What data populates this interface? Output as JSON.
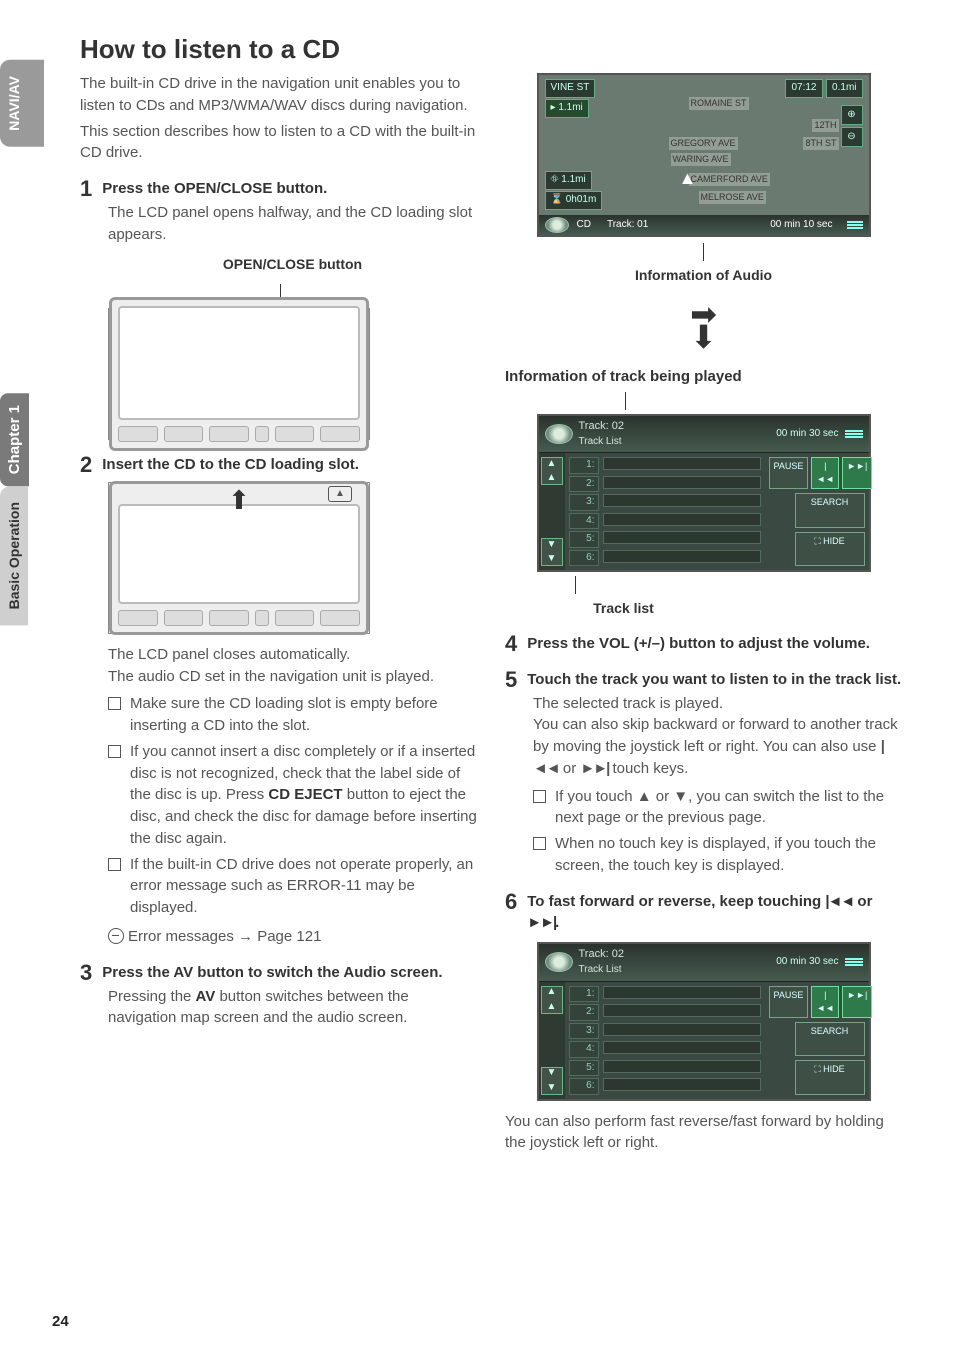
{
  "page_number": "24",
  "side": {
    "navav": "NAVI/AV",
    "chapter": "Chapter 1",
    "section": "Basic Operation"
  },
  "title_a": "How to listen to a ",
  "title_b": "CD",
  "intro1": "The built-in CD drive in the navigation unit enables you to listen to CDs and MP3/WMA/WAV discs during navigation.",
  "intro2": "This section describes how to listen to a CD with the built-in CD drive.",
  "s1": {
    "t_a": "Press the ",
    "t_b": "OPEN/CLOSE",
    "t_c": " button.",
    "body": "The LCD panel opens halfway, and the CD loading slot appears.",
    "cap": "OPEN/CLOSE button"
  },
  "s2": {
    "t_a": "Insert the ",
    "t_b": "CD",
    "t_c": " to the ",
    "t_d": "CD",
    "t_e": " loading slot.",
    "b1": "The LCD panel closes automatically.",
    "b2": "The audio CD set in the navigation unit is played.",
    "li1": "Make sure the CD loading slot is empty before inserting a CD into the slot.",
    "li2a": "If you cannot insert a disc completely or if a inserted disc is not recognized, check that the label side of the disc is up. Press ",
    "li2b": "CD EJECT",
    "li2c": " button to eject the disc, and check the disc for damage before inserting the disc again.",
    "li3": "If the built-in CD drive does not operate properly, an error message such as ERROR-11 may be displayed.",
    "ref": "Error messages → Page 121"
  },
  "s3": {
    "t": "Press the AV button to switch the Audio screen.",
    "b_a": "Pressing the ",
    "b_b": "AV",
    "b_c": " button switches between the navigation map screen and the audio screen."
  },
  "right": {
    "cap_audio": "Information of Audio",
    "cap_track": "Information of track being played",
    "cap_list": "Track list"
  },
  "s4": {
    "t_a": "Press the ",
    "t_b": "VOL (+/–)",
    "t_c": " button to adjust the volume."
  },
  "s5": {
    "t": "Touch the track you want to listen to in the track list.",
    "b1": "The selected track is played.",
    "b2a": "You can also skip backward or forward to another track by moving the joystick left or right. You can also use ",
    "b2b": " or ",
    "b2c": " touch keys.",
    "li1a": "If you touch ",
    "li1b": " or ",
    "li1c": ", you can switch the list to the next page or the previous page.",
    "li2": "When no touch key is displayed, if you touch the screen, the touch key is displayed."
  },
  "s6": {
    "t_a": "To fast forward or reverse, keep touching ",
    "t_b": " or ",
    "t_c": ".",
    "b": "You can also perform fast reverse/fast forward by holding the joystick left or right."
  },
  "nav": {
    "vine": "VINE ST",
    "romaine": "ROMAINE ST",
    "gregory": "GREGORY AVE",
    "waring": "WARING AVE",
    "camerford": "CAMERFORD AVE",
    "melrose": "MELROSE AVE",
    "eighth": "8TH ST",
    "twelfth": "12TH",
    "d1": "1.1mi",
    "d2": "1.1mi",
    "t": "0h01m",
    "top_t": "07:12",
    "top_d": "0.1mi",
    "foot_cd": "CD",
    "foot_track": "Track: 01",
    "foot_time": "00 min   10 sec"
  },
  "tl": {
    "title": "Track: 02",
    "sub": "Track List",
    "time": "00 min   30 sec",
    "rows": [
      "1:",
      "2:",
      "3:",
      "4:",
      "5:",
      "6:"
    ],
    "pause": "PAUSE",
    "prev": "|◄◄",
    "next": "►►|",
    "search": "SEARCH",
    "hide": "⛶ HIDE"
  },
  "glyph": {
    "prev": "|◄◄",
    "next": "►►|",
    "up": "△̂",
    "down": "▽̌"
  }
}
